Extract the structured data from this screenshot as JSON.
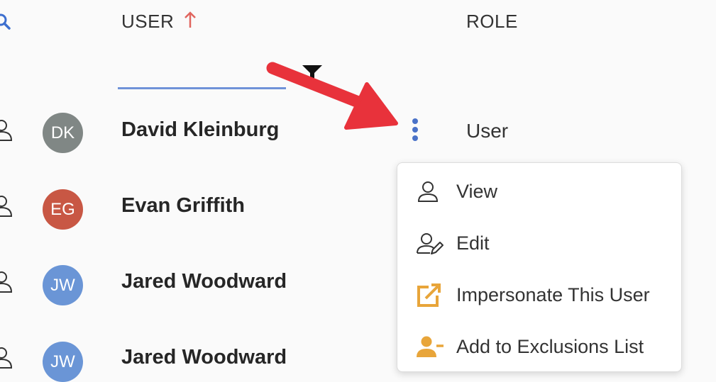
{
  "header": {
    "user_label": "USER",
    "role_label": "ROLE",
    "sort_icon": "arrow-up-icon",
    "filter_icon": "filter-funnel-icon",
    "search_icon": "search-icon"
  },
  "users": [
    {
      "initials": "DK",
      "name": "David Kleinburg",
      "role": "User",
      "avatar_color": "#808785"
    },
    {
      "initials": "EG",
      "name": "Evan Griffith",
      "avatar_color": "#c85744"
    },
    {
      "initials": "JW",
      "name": "Jared Woodward",
      "avatar_color": "#6a95d6"
    },
    {
      "initials": "JW",
      "name": "Jared Woodward",
      "avatar_color": "#6a95d6"
    }
  ],
  "context_menu": {
    "items": [
      {
        "label": "View",
        "icon": "user-icon"
      },
      {
        "label": "Edit",
        "icon": "user-edit-icon"
      },
      {
        "label": "Impersonate This User",
        "icon": "external-link-icon"
      },
      {
        "label": "Add to Exclusions List",
        "icon": "user-minus-icon"
      }
    ]
  },
  "colors": {
    "accent": "#4a72c8",
    "sort_arrow": "#e0655e",
    "annotation_arrow": "#e8323b",
    "menu_icon_orange": "#e8a53a"
  }
}
